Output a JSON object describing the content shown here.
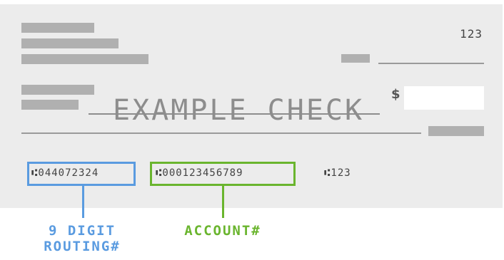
{
  "check": {
    "number": "123",
    "currency_symbol": "$",
    "watermark": "EXAMPLE CHECK",
    "micr": {
      "routing": "⑆044072324",
      "account": "⑆000123456789",
      "check_number": "⑆123"
    }
  },
  "labels": {
    "routing_line1": "9 DIGIT",
    "routing_line2": "ROUTING#",
    "account": "ACCOUNT#"
  },
  "colors": {
    "routing": "#5a9be0",
    "account": "#6ab52e"
  }
}
